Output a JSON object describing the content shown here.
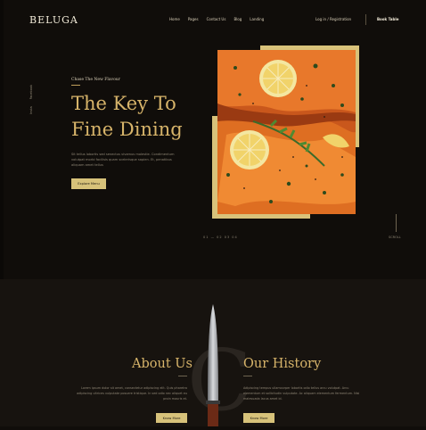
{
  "header": {
    "logo": "BELUGA",
    "nav": [
      "Home",
      "Pages",
      "Contact Us",
      "Blog",
      "Landing"
    ],
    "login": "Log in / Registration",
    "book_table": "Book Table"
  },
  "socials": [
    "Insta",
    "Facebook"
  ],
  "hero": {
    "eyebrow": "Chase The New Flavour",
    "title": "The Key To Fine Dining",
    "description": "Sit tellus lobortis sed senectus vivamus molestie. Condimentum volutpat morbi facilisis quam scelerisque sapien. Et, penatibus aliquam amet tellus",
    "button": "Explore Menu"
  },
  "slider": {
    "counter": "01 — 02 03 04",
    "scroll_label": "SCROLL"
  },
  "about": {
    "title": "About Us",
    "description": "Lorem ipsum dolor sit amet, consectetur adipiscing elit. Quis pharetra adipiscing ultrices vulputate posuere tristique. In sed odio nec aliquet eu proin mauris et.",
    "button": "Know More"
  },
  "history": {
    "title": "Our History",
    "description": "Adipiscing tempus ullamcorper lobortis odio tellus arcu volutpat. Arcu elementum et sollicitudin vulputate. Ac aliquam elementum fermentum. Nisi malesuada lacus amet id.",
    "button": "Know More"
  },
  "decor": {
    "letter": "C"
  },
  "colors": {
    "background": "#100d0a",
    "accent": "#d7b46a",
    "button": "#d7c27a",
    "frame": "#d8c27a"
  }
}
